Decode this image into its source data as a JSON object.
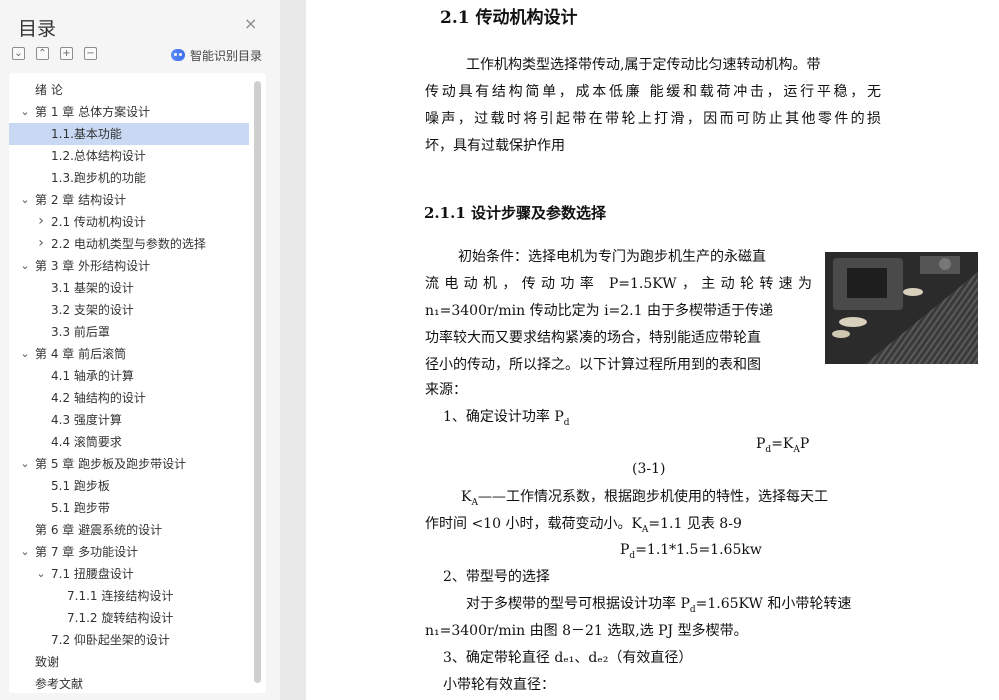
{
  "sidebar": {
    "title": "目录",
    "close_glyph": "×",
    "toolbar": [
      {
        "name": "expand-all-button",
        "glyph": "⌄"
      },
      {
        "name": "collapse-all-button",
        "glyph": "⌃"
      },
      {
        "name": "add-heading-button",
        "glyph": "+"
      },
      {
        "name": "remove-heading-button",
        "glyph": "−"
      }
    ],
    "ai_button_label": "智能识别目录",
    "ai_icon": "robot-icon",
    "selected_index": 2,
    "items": [
      {
        "label": "绪  论",
        "level": 0,
        "arrow": ""
      },
      {
        "label": "第 1 章   总体方案设计",
        "level": 0,
        "arrow": "expanded"
      },
      {
        "label": "1.1.基本功能",
        "level": 1,
        "arrow": ""
      },
      {
        "label": "1.2.总体结构设计",
        "level": 1,
        "arrow": ""
      },
      {
        "label": "1.3.跑步机的功能",
        "level": 1,
        "arrow": ""
      },
      {
        "label": "第 2 章    结构设计",
        "level": 0,
        "arrow": "expanded"
      },
      {
        "label": "2.1  传动机构设计",
        "level": 1,
        "arrow": "collapsed"
      },
      {
        "label": "2.2  电动机类型与参数的选择",
        "level": 1,
        "arrow": "collapsed"
      },
      {
        "label": "第 3 章  外形结构设计",
        "level": 0,
        "arrow": "expanded"
      },
      {
        "label": "3.1 基架的设计",
        "level": 1,
        "arrow": ""
      },
      {
        "label": "3.2 支架的设计",
        "level": 1,
        "arrow": ""
      },
      {
        "label": "3.3 前后罩",
        "level": 1,
        "arrow": ""
      },
      {
        "label": "第 4 章  前后滚筒",
        "level": 0,
        "arrow": "expanded"
      },
      {
        "label": "4.1 轴承的计算",
        "level": 1,
        "arrow": ""
      },
      {
        "label": "4.2 轴结构的设计",
        "level": 1,
        "arrow": ""
      },
      {
        "label": "4.3 强度计算",
        "level": 1,
        "arrow": ""
      },
      {
        "label": "4.4 滚筒要求",
        "level": 1,
        "arrow": ""
      },
      {
        "label": "第 5 章    跑步板及跑步带设计",
        "level": 0,
        "arrow": "expanded"
      },
      {
        "label": "5.1 跑步板",
        "level": 1,
        "arrow": ""
      },
      {
        "label": "5.1 跑步带",
        "level": 1,
        "arrow": ""
      },
      {
        "label": "第 6 章  避震系统的设计",
        "level": 0,
        "arrow": ""
      },
      {
        "label": "第 7 章  多功能设计",
        "level": 0,
        "arrow": "expanded"
      },
      {
        "label": "7.1 扭腰盘设计",
        "level": 1,
        "arrow": "expanded"
      },
      {
        "label": "7.1.1 连接结构设计",
        "level": 2,
        "arrow": ""
      },
      {
        "label": "7.1.2 旋转结构设计",
        "level": 2,
        "arrow": ""
      },
      {
        "label": "7.2  仰卧起坐架的设计",
        "level": 1,
        "arrow": ""
      },
      {
        "label": "致谢",
        "level": 0,
        "arrow": ""
      },
      {
        "label": "参考文献",
        "level": 0,
        "arrow": ""
      }
    ]
  },
  "document": {
    "heading_main": "2.1 传动机构设计",
    "para1": [
      "工作机构类型选择带传动,属于定传动比匀速转动机构。带",
      "传动具有结构简单，成本低廉   能缓和载荷冲击，运行平稳，无",
      "噪声，过载时将引起带在带轮上打滑，因而可防止其他零件的损",
      "坏，具有过载保护作用"
    ],
    "heading_sub": "2.1.1 设计步骤及参数选择",
    "para2": [
      "初始条件：选择电机为专门为跑步机生产的永磁直",
      "流电动机，传动功率 P=1.5KW，主动轮转速为",
      "n₁=3400r/min 传动比定为 i=2.1 由于多楔带适于传递",
      "功率较大而又要求结构紧凑的场合，特别能适应带轮直",
      "径小的传动，所以择之。以下计算过程所用到的表和图",
      "来源："
    ],
    "photo_icon": "treadmill-belt-photo",
    "step1": "1、确定设计功率 Pd",
    "formula1": "Pd=KAP",
    "eq_num": "(3-1)",
    "ka_line1": "KA——工作情况系数，根据跑步机使用的特性，选择每天工",
    "ka_line2": "作时间 <10 小时，载荷变动小。KA=1.1 见表 8-9",
    "formula2": "Pd=1.1*1.5=1.65kw",
    "step2": "2、带型号的选择",
    "step2_line1": "对于多楔带的型号可根据设计功率 Pd=1.65KW 和小带轮转速",
    "step2_line2": "n₁=3400r/min 由图 8－21 选取,选 PJ 型多楔带。",
    "step3": "3、确定带轮直径 dₑ₁、dₑ₂（有效直径）",
    "step3_sub": "小带轮有效直径："
  }
}
